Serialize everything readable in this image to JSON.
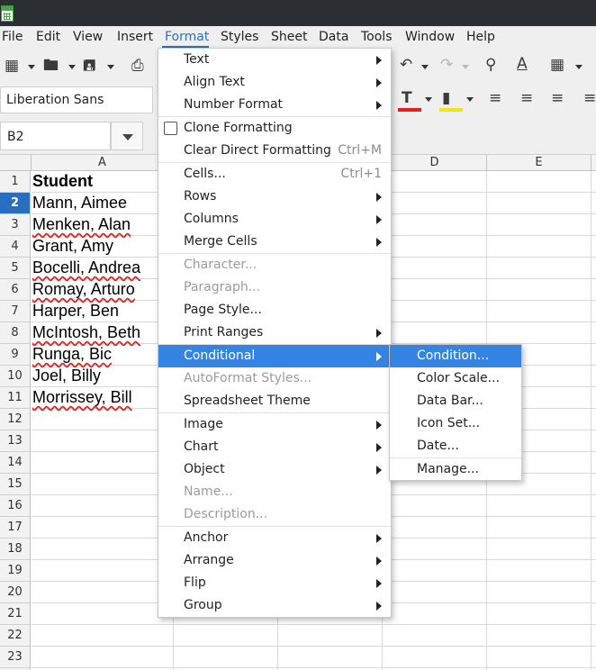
{
  "menubar": {
    "items": [
      "File",
      "Edit",
      "View",
      "Insert",
      "Format",
      "Styles",
      "Sheet",
      "Data",
      "Tools",
      "Window",
      "Help"
    ],
    "active": "Format"
  },
  "toolbar": {
    "font_name": "Liberation Sans",
    "font_color": "#e0201b",
    "highlight_color": "#f5e60a"
  },
  "namebox": {
    "value": "B2"
  },
  "grid": {
    "columns": [
      "A",
      "D",
      "E"
    ],
    "rows": [
      "1",
      "2",
      "3",
      "4",
      "5",
      "6",
      "7",
      "8",
      "9",
      "10",
      "11",
      "12",
      "13",
      "14",
      "15",
      "16",
      "17",
      "18",
      "19",
      "20",
      "21",
      "22",
      "23"
    ],
    "selected_row": "2",
    "cells": [
      {
        "text": "Student",
        "bold": true,
        "spell": false
      },
      {
        "text": "Mann, Aimee",
        "bold": false,
        "spell": false
      },
      {
        "text": "Menken, Alan",
        "bold": false,
        "spell": true
      },
      {
        "text": "Grant, Amy",
        "bold": false,
        "spell": false
      },
      {
        "text": "Bocelli, Andrea",
        "bold": false,
        "spell": true
      },
      {
        "text": "Romay, Arturo",
        "bold": false,
        "spell": true
      },
      {
        "text": "Harper, Ben",
        "bold": false,
        "spell": false
      },
      {
        "text": "McIntosh, Beth",
        "bold": false,
        "spell": true
      },
      {
        "text": "Runga, Bic",
        "bold": false,
        "spell": true
      },
      {
        "text": "Joel, Billy",
        "bold": false,
        "spell": false
      },
      {
        "text": "Morrissey, Bill",
        "bold": false,
        "spell": true
      }
    ]
  },
  "format_menu": {
    "items": [
      {
        "label": "Text",
        "submenu": true
      },
      {
        "label": "Align Text",
        "submenu": true
      },
      {
        "label": "Number Format",
        "submenu": true
      },
      {
        "label": "Clone Formatting",
        "checkbox": true
      },
      {
        "label": "Clear Direct Formatting",
        "shortcut": "Ctrl+M"
      },
      {
        "label": "Cells...",
        "shortcut": "Ctrl+1"
      },
      {
        "label": "Rows",
        "submenu": true
      },
      {
        "label": "Columns",
        "submenu": true
      },
      {
        "label": "Merge Cells",
        "submenu": true
      },
      {
        "label": "Character...",
        "disabled": true
      },
      {
        "label": "Paragraph...",
        "disabled": true
      },
      {
        "label": "Page Style..."
      },
      {
        "label": "Print Ranges",
        "submenu": true
      },
      {
        "label": "Conditional",
        "submenu": true,
        "highlighted": true
      },
      {
        "label": "AutoFormat Styles...",
        "disabled": true
      },
      {
        "label": "Spreadsheet Theme"
      },
      {
        "label": "Image",
        "submenu": true
      },
      {
        "label": "Chart",
        "submenu": true
      },
      {
        "label": "Object",
        "submenu": true
      },
      {
        "label": "Name...",
        "disabled": true
      },
      {
        "label": "Description...",
        "disabled": true
      },
      {
        "label": "Anchor",
        "submenu": true
      },
      {
        "label": "Arrange",
        "submenu": true
      },
      {
        "label": "Flip",
        "submenu": true
      },
      {
        "label": "Group",
        "submenu": true
      }
    ]
  },
  "conditional_submenu": {
    "items": [
      {
        "label": "Condition...",
        "highlighted": true
      },
      {
        "label": "Color Scale..."
      },
      {
        "label": "Data Bar..."
      },
      {
        "label": "Icon Set..."
      },
      {
        "label": "Date..."
      },
      {
        "label": "Manage..."
      }
    ]
  }
}
